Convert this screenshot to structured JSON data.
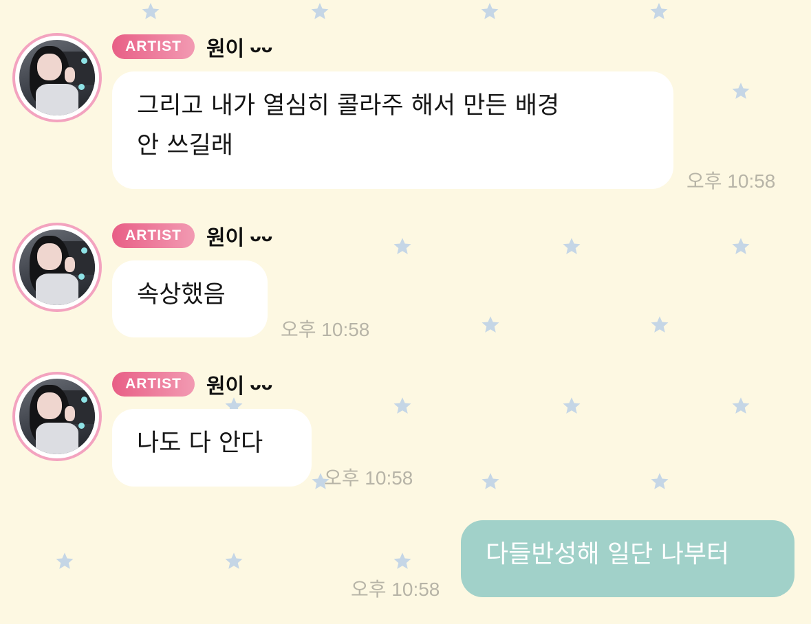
{
  "colors": {
    "background": "#fdf8e2",
    "star": "#c5d6e6",
    "badge_start": "#e85f86",
    "badge_end": "#f29ab2",
    "avatar_ring": "#f3a3bf",
    "incoming_bubble": "#ffffff",
    "outgoing_bubble": "#a1d1c9",
    "timestamp": "#b7b4a7"
  },
  "messages": [
    {
      "badge": "ARTIST",
      "sender": "원이",
      "sender_glyph": "ᴗᴗ",
      "text": "그리고 내가 열심히 콜라주 해서 만든 배경 안 쓰길래",
      "line1": "그리고 내가 열심히 콜라주 해서 만든 배경",
      "line2": "안 쓰길래",
      "time": "오후 10:58"
    },
    {
      "badge": "ARTIST",
      "sender": "원이",
      "sender_glyph": "ᴗᴗ",
      "text": "속상했음",
      "time": "오후 10:58"
    },
    {
      "badge": "ARTIST",
      "sender": "원이",
      "sender_glyph": "ᴗᴗ",
      "text": "나도 다 안다",
      "time": "오후 10:58"
    }
  ],
  "my_message": {
    "text": "다들반성해 일단 나부터",
    "time": "오후 10:58"
  }
}
